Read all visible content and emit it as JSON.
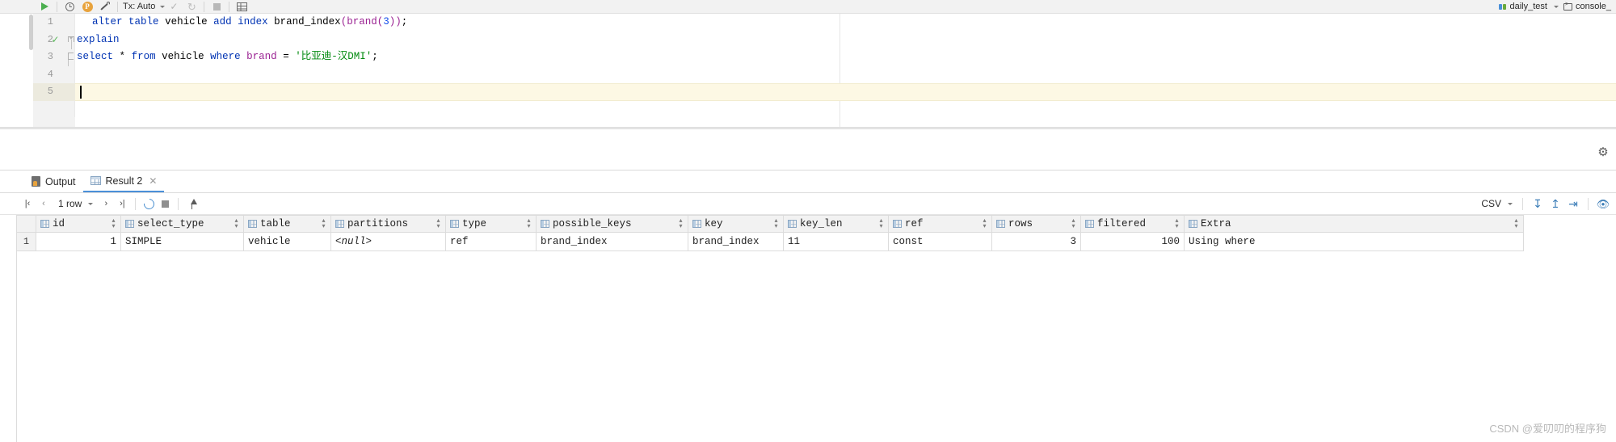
{
  "toolbar": {
    "execute_label": "Execute",
    "history_label": "History",
    "profile_label": "P",
    "tools_label": "Tools",
    "tx_label": "Tx: Auto",
    "commit_label": "Commit",
    "rollback_label": "Rollback",
    "stop_label": "Stop",
    "grid_label": "Grid",
    "datasource": "daily_test",
    "console": "console_"
  },
  "editor": {
    "lines": [
      {
        "number": "1",
        "tokens": [
          {
            "t": "  ",
            "c": "op"
          },
          {
            "t": "alter",
            "c": "kw"
          },
          {
            "t": " ",
            "c": "op"
          },
          {
            "t": "table",
            "c": "kw"
          },
          {
            "t": " ",
            "c": "op"
          },
          {
            "t": "vehicle",
            "c": "id"
          },
          {
            "t": " ",
            "c": "op"
          },
          {
            "t": "add",
            "c": "kw"
          },
          {
            "t": " ",
            "c": "op"
          },
          {
            "t": "index",
            "c": "kw"
          },
          {
            "t": " ",
            "c": "op"
          },
          {
            "t": "brand_index",
            "c": "id"
          },
          {
            "t": "(",
            "c": "pnk"
          },
          {
            "t": "brand",
            "c": "pnk"
          },
          {
            "t": "(",
            "c": "pnk"
          },
          {
            "t": "3",
            "c": "num"
          },
          {
            "t": ")",
            "c": "pnk"
          },
          {
            "t": ")",
            "c": "pnk"
          },
          {
            "t": ";",
            "c": "op"
          }
        ]
      },
      {
        "number": "2",
        "tokens": [
          {
            "t": "explain",
            "c": "kw"
          }
        ]
      },
      {
        "number": "3",
        "tokens": [
          {
            "t": "select",
            "c": "kw"
          },
          {
            "t": " ",
            "c": "op"
          },
          {
            "t": "*",
            "c": "op"
          },
          {
            "t": " ",
            "c": "op"
          },
          {
            "t": "from",
            "c": "kw"
          },
          {
            "t": " ",
            "c": "op"
          },
          {
            "t": "vehicle",
            "c": "id"
          },
          {
            "t": " ",
            "c": "op"
          },
          {
            "t": "where",
            "c": "kw"
          },
          {
            "t": " ",
            "c": "op"
          },
          {
            "t": "brand",
            "c": "pnk"
          },
          {
            "t": " ",
            "c": "op"
          },
          {
            "t": "=",
            "c": "op"
          },
          {
            "t": " ",
            "c": "op"
          },
          {
            "t": "'比亚迪-汉DMI'",
            "c": "str"
          },
          {
            "t": ";",
            "c": "op"
          }
        ]
      },
      {
        "number": "4",
        "tokens": []
      },
      {
        "number": "5",
        "tokens": []
      }
    ],
    "caret_line": 5,
    "success_marker_line": 2
  },
  "results": {
    "tabs": [
      {
        "label": "Output",
        "icon": "output-icon",
        "active": false,
        "closable": false
      },
      {
        "label": "Result 2",
        "icon": "table-icon",
        "active": true,
        "closable": true
      }
    ],
    "grid_toolbar": {
      "first_label": "First row",
      "prev_label": "Previous row",
      "row_count": "1 row",
      "next_label": "Next row",
      "last_label": "Last row",
      "reload_label": "Reload page",
      "stop_label": "Stop",
      "pin_label": "Pin tab",
      "export_format": "CSV",
      "download_label": "Export data",
      "upload_label": "Import data",
      "compare_label": "Compare",
      "view_label": "View options"
    },
    "table": {
      "columns": [
        "id",
        "select_type",
        "table",
        "partitions",
        "type",
        "possible_keys",
        "key",
        "key_len",
        "ref",
        "rows",
        "filtered",
        "Extra"
      ],
      "rows": [
        {
          "num": "1",
          "cells": [
            {
              "v": "1",
              "align": "numeric"
            },
            {
              "v": "SIMPLE",
              "align": "left"
            },
            {
              "v": "vehicle",
              "align": "left"
            },
            {
              "v": "<null>",
              "align": "null"
            },
            {
              "v": "ref",
              "align": "left"
            },
            {
              "v": "brand_index",
              "align": "left"
            },
            {
              "v": "brand_index",
              "align": "left"
            },
            {
              "v": "11",
              "align": "left"
            },
            {
              "v": "const",
              "align": "left"
            },
            {
              "v": "3",
              "align": "numeric"
            },
            {
              "v": "100",
              "align": "numeric"
            },
            {
              "v": "Using where",
              "align": "left"
            }
          ]
        }
      ]
    }
  },
  "watermark": "CSDN @爱叨叨的程序狗"
}
